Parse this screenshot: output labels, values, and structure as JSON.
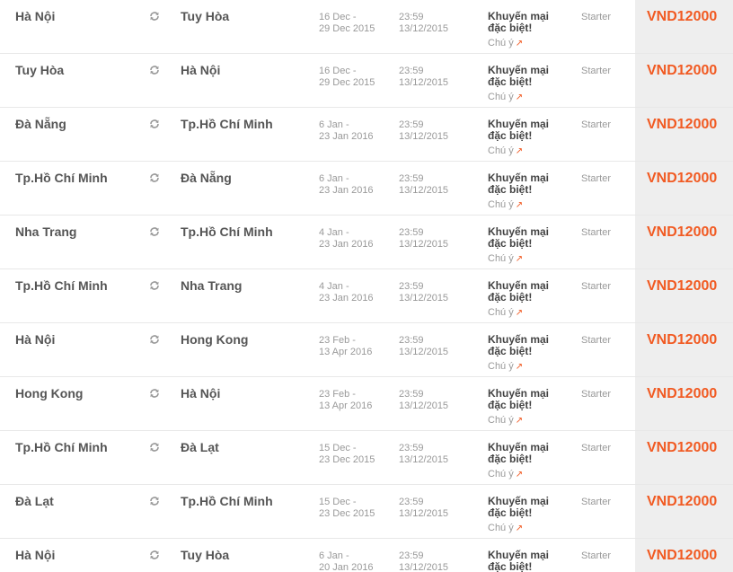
{
  "labels": {
    "note": "Chú ý"
  },
  "colors": {
    "price": "#f15a22",
    "price_column_bg": "#eeeeee",
    "route_text": "#555555",
    "muted_text": "#999999"
  },
  "icons": {
    "swap": "return-trip-icon",
    "note_arrow": "external-arrow-icon"
  },
  "fares": [
    {
      "origin": "Hà Nội",
      "destination": "Tuy Hòa",
      "travel_start": "16 Dec -",
      "travel_end": "29 Dec 2015",
      "deadline_time": "23:59",
      "deadline_date": "13/12/2015",
      "promo_line1": "Khuyến mại",
      "promo_line2": "đặc biệt!",
      "fare_class": "Starter",
      "price": "VND12000"
    },
    {
      "origin": "Tuy Hòa",
      "destination": "Hà Nội",
      "travel_start": "16 Dec -",
      "travel_end": "29 Dec 2015",
      "deadline_time": "23:59",
      "deadline_date": "13/12/2015",
      "promo_line1": "Khuyến mại",
      "promo_line2": "đặc biệt!",
      "fare_class": "Starter",
      "price": "VND12000"
    },
    {
      "origin": "Đà Nẵng",
      "destination": "Tp.Hồ Chí Minh",
      "travel_start": "6 Jan -",
      "travel_end": "23 Jan 2016",
      "deadline_time": "23:59",
      "deadline_date": "13/12/2015",
      "promo_line1": "Khuyến mại",
      "promo_line2": "đặc biệt!",
      "fare_class": "Starter",
      "price": "VND12000"
    },
    {
      "origin": "Tp.Hồ Chí Minh",
      "destination": "Đà Nẵng",
      "travel_start": "6 Jan -",
      "travel_end": "23 Jan 2016",
      "deadline_time": "23:59",
      "deadline_date": "13/12/2015",
      "promo_line1": "Khuyến mại",
      "promo_line2": "đặc biệt!",
      "fare_class": "Starter",
      "price": "VND12000"
    },
    {
      "origin": "Nha Trang",
      "destination": "Tp.Hồ Chí Minh",
      "travel_start": "4 Jan -",
      "travel_end": "23 Jan 2016",
      "deadline_time": "23:59",
      "deadline_date": "13/12/2015",
      "promo_line1": "Khuyến mại",
      "promo_line2": "đặc biệt!",
      "fare_class": "Starter",
      "price": "VND12000"
    },
    {
      "origin": "Tp.Hồ Chí Minh",
      "destination": "Nha Trang",
      "travel_start": "4 Jan -",
      "travel_end": "23 Jan 2016",
      "deadline_time": "23:59",
      "deadline_date": "13/12/2015",
      "promo_line1": "Khuyến mại",
      "promo_line2": "đặc biệt!",
      "fare_class": "Starter",
      "price": "VND12000"
    },
    {
      "origin": "Hà Nội",
      "destination": "Hong Kong",
      "travel_start": "23 Feb -",
      "travel_end": "13 Apr 2016",
      "deadline_time": "23:59",
      "deadline_date": "13/12/2015",
      "promo_line1": "Khuyến mại",
      "promo_line2": "đặc biệt!",
      "fare_class": "Starter",
      "price": "VND12000"
    },
    {
      "origin": "Hong Kong",
      "destination": "Hà Nội",
      "travel_start": "23 Feb -",
      "travel_end": "13 Apr 2016",
      "deadline_time": "23:59",
      "deadline_date": "13/12/2015",
      "promo_line1": "Khuyến mại",
      "promo_line2": "đặc biệt!",
      "fare_class": "Starter",
      "price": "VND12000"
    },
    {
      "origin": "Tp.Hồ Chí Minh",
      "destination": "Đà Lạt",
      "travel_start": "15 Dec -",
      "travel_end": "23 Dec 2015",
      "deadline_time": "23:59",
      "deadline_date": "13/12/2015",
      "promo_line1": "Khuyến mại",
      "promo_line2": "đặc biệt!",
      "fare_class": "Starter",
      "price": "VND12000"
    },
    {
      "origin": "Đà Lạt",
      "destination": "Tp.Hồ Chí Minh",
      "travel_start": "15 Dec -",
      "travel_end": "23 Dec 2015",
      "deadline_time": "23:59",
      "deadline_date": "13/12/2015",
      "promo_line1": "Khuyến mại",
      "promo_line2": "đặc biệt!",
      "fare_class": "Starter",
      "price": "VND12000"
    },
    {
      "origin": "Hà Nội",
      "destination": "Tuy Hòa",
      "travel_start": "6 Jan -",
      "travel_end": "20 Jan 2016",
      "deadline_time": "23:59",
      "deadline_date": "13/12/2015",
      "promo_line1": "Khuyến mại",
      "promo_line2": "đặc biệt!",
      "fare_class": "Starter",
      "price": "VND12000"
    }
  ]
}
